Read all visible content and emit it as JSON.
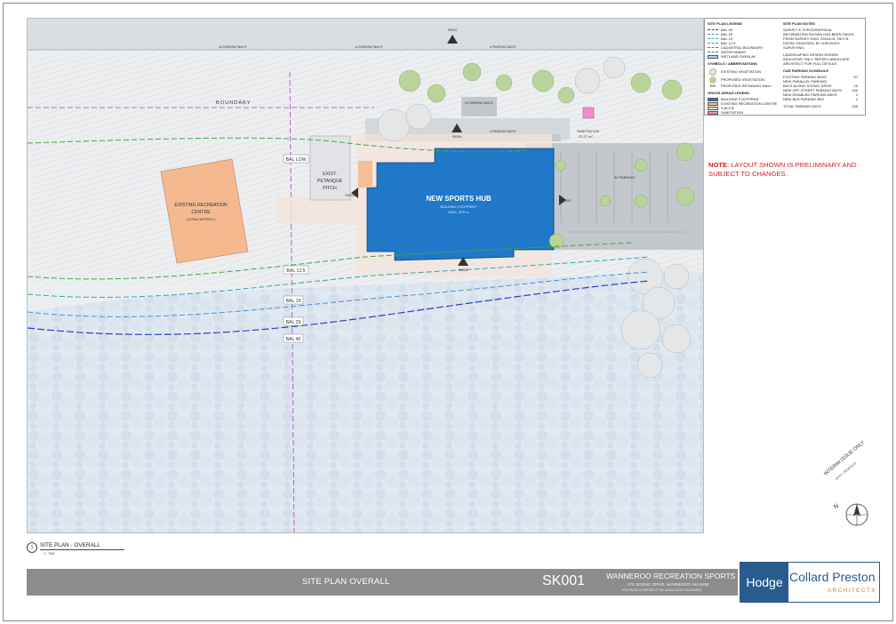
{
  "plan": {
    "labels": {
      "boundary": "BOUNDARY",
      "existing_centre_1": "EXISTING RECREATION",
      "existing_centre_2": "CENTRE",
      "existing_centre_3": "(1470m2 APPROX.)",
      "exist_petanque_1": "EXIST.",
      "exist_petanque_2": "PETANQUE",
      "exist_petanque_3": "PITCH",
      "new_hub": "NEW SPORTS HUB",
      "hub_sub_1": "BUILDING FOOTPRINT",
      "hub_sub_2": "AREA: 1879 m²",
      "substation": "SUBSTATION",
      "substation_area": "31.27 m²",
      "parking_15": "15 PARKING BAYS",
      "parking_14": "14 PARKING BAYS",
      "parking_6": "6 PARKING BAYS",
      "parking_24": "24 PARKING BAYS",
      "parking_3": "3 PARKING BAYS",
      "parking_93": "93 PARKING",
      "bal_low": "BAL LOW",
      "bal_125": "BAL 12.5",
      "bal_19": "BAL 19",
      "bal_29": "BAL 29",
      "bal_40": "BAL 40",
      "sk_top": "SK002",
      "sk_left": "SK003",
      "sk_right": "SK005",
      "sk_bottom": "SK200",
      "sk_entry": "SK004"
    }
  },
  "legend": {
    "site_plan_legend_title": "SITE PLAN LEGEND",
    "lines": [
      {
        "label": "BAL 40",
        "color": "#2a3fbf"
      },
      {
        "label": "BAL 29",
        "color": "#4a8fd6"
      },
      {
        "label": "BAL 19",
        "color": "#2fa7b4"
      },
      {
        "label": "BAL 12.5",
        "color": "#3ea844"
      },
      {
        "label": "CADASTRAL BOUNDARY",
        "color": "#b03fb8"
      },
      {
        "label": "WATER MAINS",
        "color": "#3a63d0"
      },
      {
        "label": "WETLAND OVERLAY",
        "color": "#aed3ec"
      }
    ],
    "symbols_title": "SYMBOLS / ABBREVIATIONS",
    "symbols": [
      {
        "label": "EXISTING VEGETATION",
        "color": "#e6e6e6"
      },
      {
        "label": "PROPOSED VEGETATION",
        "color": "#b9d39a"
      }
    ],
    "rw_abbrev": "RW",
    "rw_label": "PROPOSED RETAINING WALL",
    "gross_title": "GROSS AREAS LEGEND",
    "areas": [
      {
        "label": "BUILDING FOOTPRINT",
        "color": "#1f78c8"
      },
      {
        "label": "EXISTING RECREATION CENTRE",
        "color": "#f4b98f"
      },
      {
        "label": "S.M.S.B",
        "color": "#d7ecd0"
      },
      {
        "label": "SUBSTATION",
        "color": "#f28cc8"
      }
    ],
    "notes_title": "SITE PLAN NOTES",
    "notes": [
      "SURVEY & TOPOGRAPHICAL INFORMATION SHOWN HAS BEEN TAKEN FROM SURVEY DWG: 25118-01, REV B, DATED 25/10/2024, BY JUROVICH SURVEYING.",
      "LANDSCAPING DESIGN SHOWN INDICATIVE ONLY. REFER LANDSCAPE ARCHITECT FOR FULL DETAILS"
    ],
    "schedule_title": "CAR PARKING SCHEDULE",
    "schedule": [
      {
        "label": "EXISTING PARKING BAYS",
        "value": "67"
      },
      {
        "label": "NEW PARALLEL PARKING",
        "value": ""
      },
      {
        "label": "BAYS ALONG SCENIC DRIVE",
        "value": "25"
      },
      {
        "label": "NEW OFF-STREET PARKING BAYS",
        "value": "100"
      },
      {
        "label": "NEW DISABLED PARKING BAYS",
        "value": "2"
      },
      {
        "label": "NEW BUS PARKING BAY",
        "value": "1"
      }
    ],
    "schedule_total_label": "TOTAL PARKING BAYS",
    "schedule_total_value": "195"
  },
  "note": {
    "prefix": "NOTE",
    "text": ": LAYOUT SHOWN IS PRELIMINARY AND SUBJECT TO CHANGES."
  },
  "view": {
    "number": "1",
    "name": "SITE PLAN - OVERALL",
    "scale": "1 : 500"
  },
  "titleblock": {
    "sheet_title": "SITE PLAN OVERALL",
    "sheet_number": "SK001",
    "project": "WANNEROO RECREATION SPORTS HUB",
    "address": "275 SCENIC DRIVE, WANNEROO WA 6065",
    "revision": "REVISION A        PROJECT NO.11524  DATE 24/06/2025"
  },
  "stamp": {
    "text": "INTERIM ISSUE ONLY",
    "date": "DATE: 24/06/2025"
  },
  "logo": {
    "word1": "Hodge",
    "word2": "Collard Preston",
    "word3": "ARCHITECTS"
  },
  "colors": {
    "building": "#1f78c8",
    "existing_centre": "#f4b98f",
    "substation": "#f28cc8",
    "bal40": "#2a3fbf",
    "bal29": "#4a8fd6",
    "bal19": "#2fa7b4",
    "bal125": "#3ea844",
    "cadastral": "#b03fb8",
    "note_red": "#d21f1f",
    "brand_blue": "#2a5b8e",
    "brand_orange": "#d07c2d"
  }
}
